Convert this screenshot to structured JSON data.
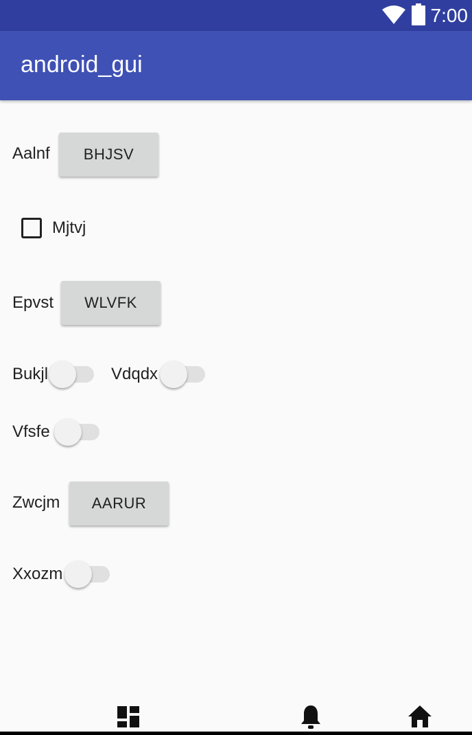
{
  "status_bar": {
    "time": "7:00",
    "icons": [
      "wifi-icon",
      "battery-icon"
    ],
    "background": "#303f9f"
  },
  "app_bar": {
    "title": "android_gui",
    "background": "#3f51b5"
  },
  "rows": {
    "row1": {
      "label": "Aalnf",
      "button": "BHJSV"
    },
    "checkbox": {
      "label": "Mjtvj",
      "checked": false
    },
    "row3": {
      "label": "Epvst",
      "button": "WLVFK"
    },
    "switch1": {
      "label": "Bukjl",
      "on": false
    },
    "switch2": {
      "label": "Vdqdx",
      "on": false
    },
    "switch3": {
      "label": "Vfsfe",
      "on": false
    },
    "row6": {
      "label": "Zwcjm",
      "button": "AARUR"
    },
    "switch4": {
      "label": "Xxozm",
      "on": false
    }
  },
  "bottom_nav": {
    "icons": [
      "dashboard-icon",
      "notifications-icon",
      "home-icon"
    ]
  }
}
